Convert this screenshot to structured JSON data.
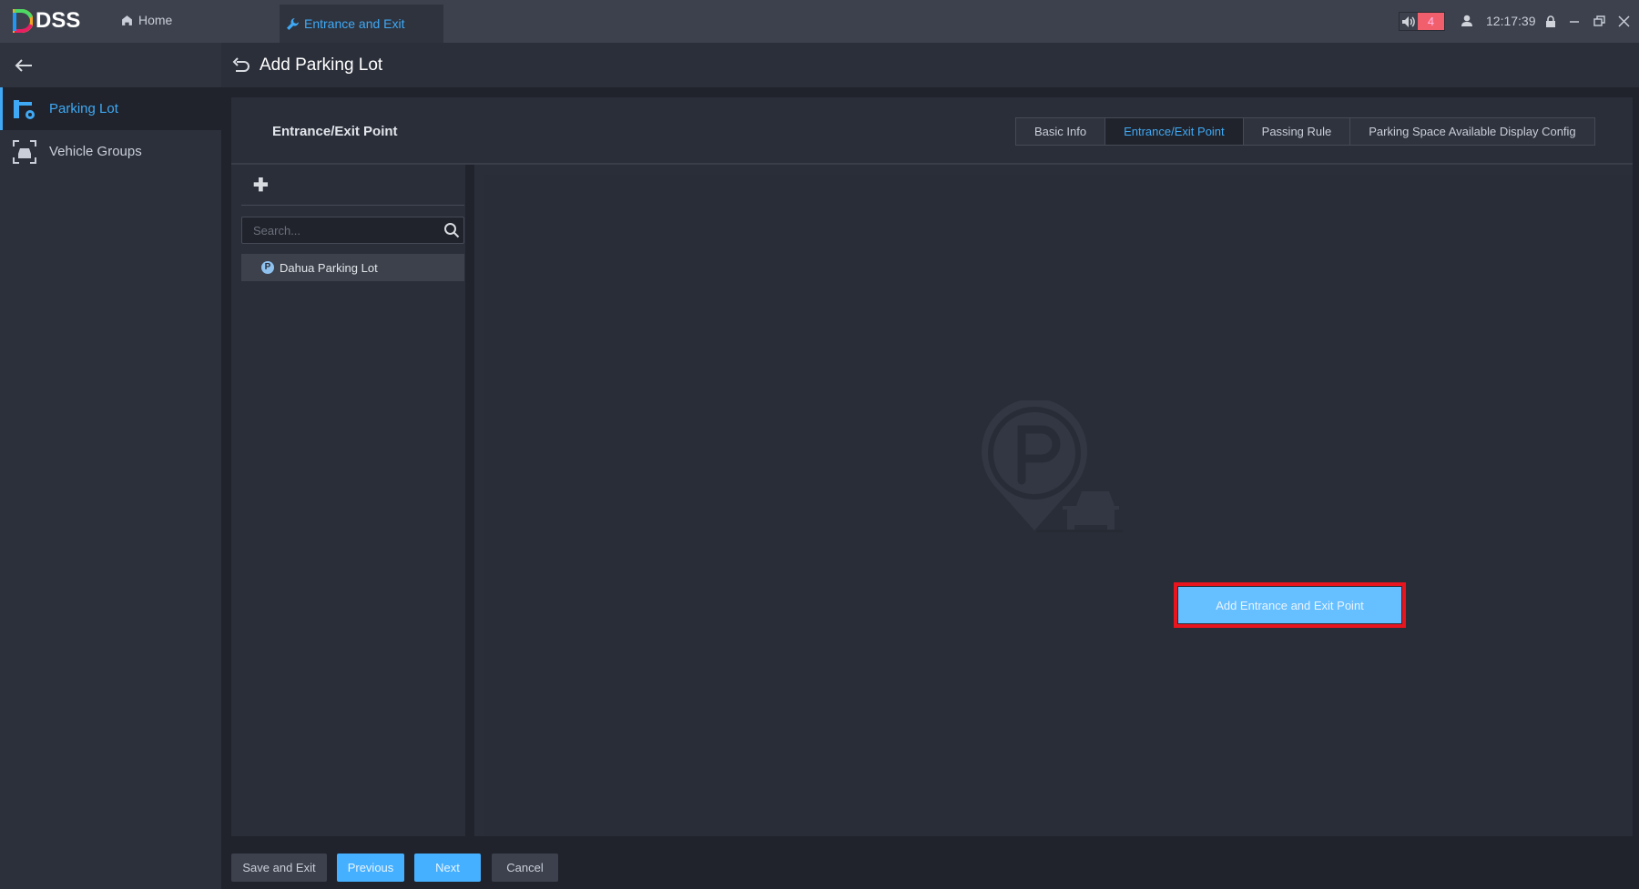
{
  "app": {
    "name": "DSS"
  },
  "topbar": {
    "home_label": "Home",
    "active_tab": "Entrance and Exit",
    "alarm_count": "4",
    "time": "12:17:39"
  },
  "sidebar": {
    "items": [
      {
        "label": "Parking Lot",
        "active": true
      },
      {
        "label": "Vehicle Groups",
        "active": false
      }
    ]
  },
  "header": {
    "title": "Add Parking Lot"
  },
  "panel": {
    "title": "Entrance/Exit Point",
    "steps": [
      {
        "label": "Basic Info"
      },
      {
        "label": "Entrance/Exit Point",
        "active": true
      },
      {
        "label": "Passing Rule"
      },
      {
        "label": "Parking Space Available Display Config"
      }
    ]
  },
  "tree": {
    "search_placeholder": "Search...",
    "items": [
      {
        "label": "Dahua Parking Lot",
        "icon": "P"
      }
    ]
  },
  "empty": {
    "button_label": "Add Entrance and Exit Point"
  },
  "footer": {
    "save_exit": "Save and Exit",
    "previous": "Previous",
    "next": "Next",
    "cancel": "Cancel"
  },
  "colors": {
    "accent": "#3fa9f5",
    "alarm": "#f25f6c",
    "highlight": "#e8141e"
  }
}
